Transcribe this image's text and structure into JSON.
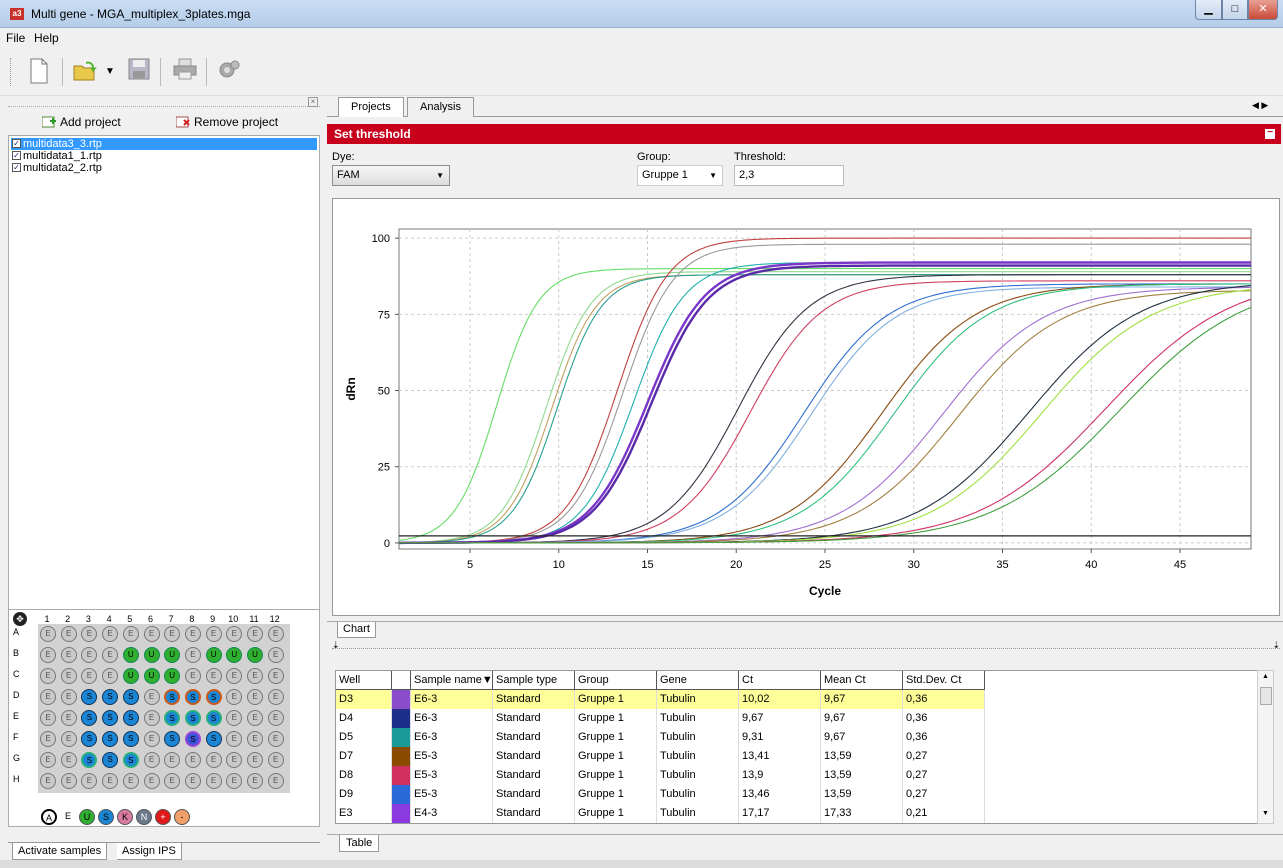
{
  "window": {
    "title": "Multi gene - MGA_multiplex_3plates.mga",
    "app_icon": "a3"
  },
  "menu": [
    "File",
    "Help"
  ],
  "toolbar": {
    "icons": [
      "new-file-icon",
      "open-folder-icon",
      "dropdown-arrow-icon",
      "save-icon",
      "print-icon",
      "settings-icon"
    ]
  },
  "projects": {
    "add_label": "Add project",
    "remove_label": "Remove project",
    "items": [
      {
        "name": "multidata3_3.rtp",
        "checked": true,
        "selected": true
      },
      {
        "name": "multidata1_1.rtp",
        "checked": true,
        "selected": false
      },
      {
        "name": "multidata2_2.rtp",
        "checked": true,
        "selected": false
      }
    ]
  },
  "plate": {
    "columns": [
      "1",
      "2",
      "3",
      "4",
      "5",
      "6",
      "7",
      "8",
      "9",
      "10",
      "11",
      "12"
    ],
    "rows": [
      "A",
      "B",
      "C",
      "D",
      "E",
      "F",
      "G",
      "H"
    ],
    "wells": [
      [
        "E",
        "E",
        "E",
        "E",
        "E",
        "E",
        "E",
        "E",
        "E",
        "E",
        "E",
        "E"
      ],
      [
        "E",
        "E",
        "E",
        "E",
        "U",
        "U",
        "U",
        "E",
        "U",
        "U",
        "U",
        "E"
      ],
      [
        "E",
        "E",
        "E",
        "E",
        "U",
        "U",
        "U",
        "E",
        "E",
        "E",
        "E",
        "E"
      ],
      [
        "E",
        "E",
        "S",
        "S",
        "S",
        "E",
        "Sr",
        "Sr",
        "Sr",
        "E",
        "E",
        "E"
      ],
      [
        "E",
        "E",
        "S",
        "S",
        "S",
        "E",
        "Sg",
        "Sg",
        "Sg",
        "E",
        "E",
        "E"
      ],
      [
        "E",
        "E",
        "S",
        "S",
        "S",
        "E",
        "S",
        "Sp",
        "S",
        "E",
        "E",
        "E"
      ],
      [
        "E",
        "E",
        "Sg",
        "S",
        "Sg",
        "E",
        "E",
        "E",
        "E",
        "E",
        "E",
        "E"
      ],
      [
        "E",
        "E",
        "E",
        "E",
        "E",
        "E",
        "E",
        "E",
        "E",
        "E",
        "E",
        "E"
      ]
    ],
    "legend": [
      {
        "letter": "A",
        "color": "#ffffff"
      },
      {
        "letter": "E",
        "color": "#f0f0f0"
      },
      {
        "letter": "U",
        "color": "#2fae2f"
      },
      {
        "letter": "S",
        "color": "#1b86d6"
      },
      {
        "letter": "K",
        "color": "#d97aa0"
      },
      {
        "letter": "N",
        "color": "#6a7a8a"
      },
      {
        "letter": "+",
        "color": "#e01a1a"
      },
      {
        "letter": "-",
        "color": "#f2a06a"
      }
    ]
  },
  "left_tabs": [
    "Activate samples",
    "Assign IPS"
  ],
  "tabs": [
    "Projects",
    "Analysis"
  ],
  "panel": {
    "banner": "Set threshold",
    "dye_label": "Dye:",
    "dye_value": "FAM",
    "group_label": "Group:",
    "group_value": "Gruppe 1",
    "threshold_label": "Threshold:",
    "threshold_value": "2,3"
  },
  "chart_data": {
    "type": "line",
    "title": "",
    "xlabel": "Cycle",
    "ylabel": "dRn",
    "xlim": [
      1,
      49
    ],
    "ylim": [
      -2,
      103
    ],
    "xticks": [
      5,
      10,
      15,
      20,
      25,
      30,
      35,
      40,
      45
    ],
    "yticks": [
      0,
      25,
      50,
      75,
      100
    ],
    "grid": true,
    "threshold": 2.3,
    "series": [
      {
        "color": "#66dd66",
        "midpoint": 6.5,
        "plateau": 90,
        "slope": 0.85,
        "values_note": ""
      },
      {
        "color": "#8cd98c",
        "midpoint": 9.3,
        "plateau": 89,
        "slope": 0.8
      },
      {
        "color": "#c0a060",
        "midpoint": 9.6,
        "plateau": 88,
        "slope": 0.8
      },
      {
        "color": "#2aa090",
        "midpoint": 9.9,
        "plateau": 88,
        "slope": 0.8
      },
      {
        "color": "#c04040",
        "midpoint": 13.3,
        "plateau": 100,
        "slope": 0.7
      },
      {
        "color": "#999999",
        "midpoint": 13.6,
        "plateau": 98,
        "slope": 0.7
      },
      {
        "color": "#20b0b0",
        "midpoint": 14.2,
        "plateau": 92,
        "slope": 0.7
      },
      {
        "color": "#7a36c8",
        "midpoint": 15.0,
        "plateau": 92,
        "slope": 0.62
      },
      {
        "color": "#5a2aa8",
        "midpoint": 15.2,
        "plateau": 91,
        "slope": 0.62
      },
      {
        "color": "#333344",
        "midpoint": 20.1,
        "plateau": 88,
        "slope": 0.5
      },
      {
        "color": "#d04060",
        "midpoint": 20.8,
        "plateau": 86,
        "slope": 0.5
      },
      {
        "color": "#3070d0",
        "midpoint": 23.8,
        "plateau": 85,
        "slope": 0.42
      },
      {
        "color": "#80b0e0",
        "midpoint": 24.2,
        "plateau": 84,
        "slope": 0.42
      },
      {
        "color": "#8a4a10",
        "midpoint": 28.2,
        "plateau": 85,
        "slope": 0.38
      },
      {
        "color": "#30c080",
        "midpoint": 28.9,
        "plateau": 85,
        "slope": 0.38
      },
      {
        "color": "#a070d0",
        "midpoint": 31.6,
        "plateau": 84,
        "slope": 0.35
      },
      {
        "color": "#a08040",
        "midpoint": 32.5,
        "plateau": 83,
        "slope": 0.35
      },
      {
        "color": "#203040",
        "midpoint": 36.5,
        "plateau": 86,
        "slope": 0.32
      },
      {
        "color": "#a0e040",
        "midpoint": 37.2,
        "plateau": 85,
        "slope": 0.32
      },
      {
        "color": "#d03060",
        "midpoint": 40.8,
        "plateau": 88,
        "slope": 0.28
      },
      {
        "color": "#40a040",
        "midpoint": 41.6,
        "plateau": 87,
        "slope": 0.28
      }
    ]
  },
  "chart_tab": "Chart",
  "table": {
    "columns": [
      "Well",
      "",
      "Sample name",
      "Sample type",
      "Group",
      "Gene",
      "Ct",
      "Mean Ct",
      "Std.Dev. Ct"
    ],
    "sort_indicator": "▼",
    "rows": [
      {
        "well": "D3",
        "color": "#8a4cc8",
        "sample": "E6-3",
        "type": "Standard",
        "group": "Gruppe 1",
        "gene": "Tubulin",
        "ct": "10,02",
        "mean": "9,67",
        "sd": "0,36",
        "highlight": true
      },
      {
        "well": "D4",
        "color": "#1b2f8a",
        "sample": "E6-3",
        "type": "Standard",
        "group": "Gruppe 1",
        "gene": "Tubulin",
        "ct": "9,67",
        "mean": "9,67",
        "sd": "0,36",
        "highlight": false
      },
      {
        "well": "D5",
        "color": "#1b9a9a",
        "sample": "E6-3",
        "type": "Standard",
        "group": "Gruppe 1",
        "gene": "Tubulin",
        "ct": "9,31",
        "mean": "9,67",
        "sd": "0,36",
        "highlight": false
      },
      {
        "well": "D7",
        "color": "#8a4a00",
        "sample": "E5-3",
        "type": "Standard",
        "group": "Gruppe 1",
        "gene": "Tubulin",
        "ct": "13,41",
        "mean": "13,59",
        "sd": "0,27",
        "highlight": false
      },
      {
        "well": "D8",
        "color": "#d03060",
        "sample": "E5-3",
        "type": "Standard",
        "group": "Gruppe 1",
        "gene": "Tubulin",
        "ct": "13,9",
        "mean": "13,59",
        "sd": "0,27",
        "highlight": false
      },
      {
        "well": "D9",
        "color": "#2a6ad8",
        "sample": "E5-3",
        "type": "Standard",
        "group": "Gruppe 1",
        "gene": "Tubulin",
        "ct": "13,46",
        "mean": "13,59",
        "sd": "0,27",
        "highlight": false
      },
      {
        "well": "E3",
        "color": "#8a3ae0",
        "sample": "E4-3",
        "type": "Standard",
        "group": "Gruppe 1",
        "gene": "Tubulin",
        "ct": "17,17",
        "mean": "17,33",
        "sd": "0,21",
        "highlight": false
      }
    ]
  },
  "table_tab": "Table"
}
